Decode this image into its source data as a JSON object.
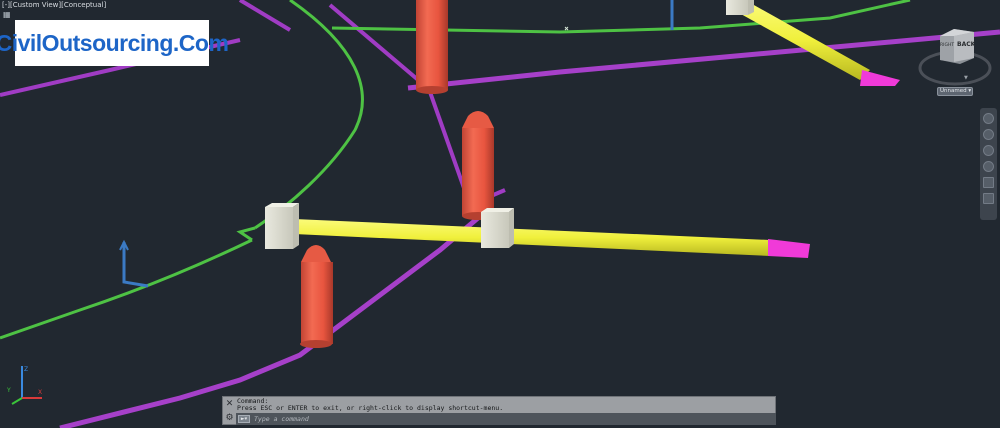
{
  "viewport": {
    "label": "[-][Custom View][Conceptual]",
    "layer_icon": "layers-icon"
  },
  "watermark": {
    "text": "CivilOutsourcing.Com"
  },
  "viewcube": {
    "face_label": "BACK",
    "side_label": "RIGHT",
    "wcs_label": "Unnamed"
  },
  "navigation_bar": {
    "items": [
      "full-navigation-wheel-icon",
      "pan-icon",
      "zoom-icon",
      "orbit-icon",
      "showmotion-icon"
    ]
  },
  "command_line": {
    "history": [
      "Command:",
      "Press ESC or ENTER to exit, or right-click to display shortcut-menu."
    ],
    "placeholder": "Type a command",
    "prompt_icon": "command-prompt-icon"
  },
  "colors": {
    "background": "#212830",
    "green_polyline": "#4ec244",
    "purple_pipe": "#a640c9",
    "yellow_pipe": "#f2f24a",
    "orange_column": "#ef5a45",
    "magenta_end": "#f03ad8",
    "box": "#ddddd2",
    "watermark_blue": "#1d65c7"
  }
}
